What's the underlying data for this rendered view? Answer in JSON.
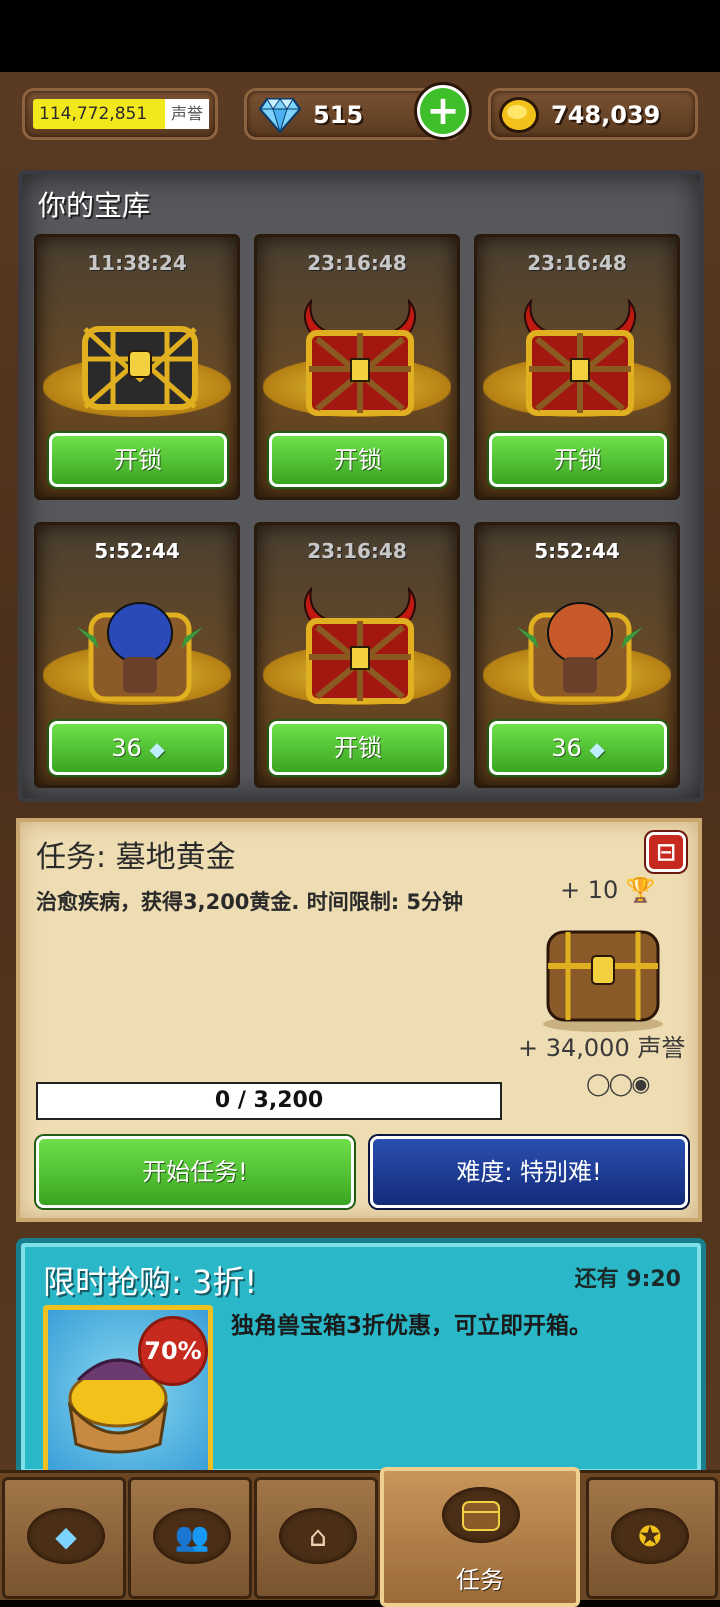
{
  "topbar": {
    "reputation_value": "114,772,851",
    "reputation_label": "声誉",
    "gems": "515",
    "gold": "748,039"
  },
  "vault": {
    "title": "你的宝库",
    "chests": [
      {
        "timer": "11:38:24",
        "button": "开锁"
      },
      {
        "timer": "23:16:48",
        "button": "开锁"
      },
      {
        "timer": "23:16:48",
        "button": "开锁"
      },
      {
        "timer": "5:52:44",
        "button": "36"
      },
      {
        "timer": "23:16:48",
        "button": "开锁"
      },
      {
        "timer": "5:52:44",
        "button": "36"
      }
    ]
  },
  "mission": {
    "title": "任务: 墓地黄金",
    "close_symbol": "⊟",
    "description": "治愈疾病，获得3,200黄金. 时间限制: 5分钟",
    "trophy_reward": "+ 10",
    "fame_reward": "+ 34,000 声誉",
    "difficulty_circles": "◯◯◉",
    "progress": "0 / 3,200",
    "start_button": "开始任务!",
    "difficulty_button": "难度: 特别难!"
  },
  "sale": {
    "title": "限时抢购: 3折!",
    "remaining": "还有 9:20",
    "badge": "70%",
    "description": "独角兽宝箱3折优惠，可立即开箱。"
  },
  "nav": {
    "tabs": [
      {
        "icon": "gem-icon",
        "label": ""
      },
      {
        "icon": "people-icon",
        "label": ""
      },
      {
        "icon": "building-icon",
        "label": ""
      },
      {
        "icon": "chest-icon",
        "label": "任务",
        "active": true
      },
      {
        "icon": "medal-icon",
        "label": ""
      }
    ]
  },
  "colors": {
    "green_button": "#3aa521",
    "blue_button": "#132a7a",
    "sale_panel": "#2ab8c8",
    "mission_panel": "#eedcb2"
  }
}
